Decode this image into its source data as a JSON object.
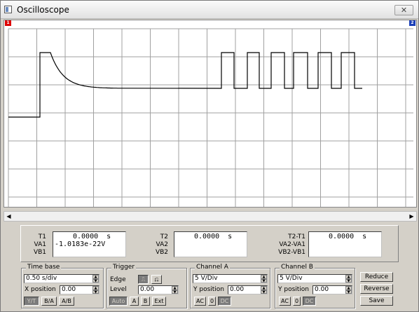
{
  "window": {
    "title": "Oscilloscope",
    "close_label": "✕"
  },
  "screen": {
    "marker_a": "1",
    "marker_b": "2",
    "grid_color": "#a0a0a0",
    "trace_color": "#000000"
  },
  "scrollbar": {
    "left_arrow": "◀",
    "right_arrow": "▶"
  },
  "readout": {
    "t1": {
      "label": "T1",
      "time": "0.0000  s",
      "va_label": "VA1",
      "va_value": "-1.0183e-22V",
      "vb_label": "VB1",
      "vb_value": ""
    },
    "t2": {
      "label": "T2",
      "time": "0.0000  s",
      "va_label": "VA2",
      "va_value": "",
      "vb_label": "VB2",
      "vb_value": ""
    },
    "diff": {
      "label": "T2-T1",
      "time": "0.0000  s",
      "va_label": "VA2-VA1",
      "va_value": "",
      "vb_label": "VB2-VB1",
      "vb_value": ""
    }
  },
  "timebase": {
    "title": "Time base",
    "value": "0.50 s/div",
    "xpos_label": "X position",
    "xpos_value": "0.00",
    "modes": [
      "Y/T",
      "B/A",
      "A/B"
    ]
  },
  "trigger": {
    "title": "Trigger",
    "edge_label": "Edge",
    "edge_rising": "⎍",
    "edge_falling": "⎌",
    "level_label": "Level",
    "level_value": "0.00",
    "sources": [
      "Auto",
      "A",
      "B",
      "Ext"
    ]
  },
  "channel_a": {
    "title": "Channel A",
    "value": "5 V/Div",
    "ypos_label": "Y position",
    "ypos_value": "0.00",
    "coupling": [
      "AC",
      "0",
      "DC"
    ]
  },
  "channel_b": {
    "title": "Channel B",
    "value": "5 V/Div",
    "ypos_label": "Y position",
    "ypos_value": "0.00",
    "coupling": [
      "AC",
      "0",
      "DC"
    ]
  },
  "actions": {
    "reduce": "Reduce",
    "reverse": "Reverse",
    "save": "Save"
  }
}
